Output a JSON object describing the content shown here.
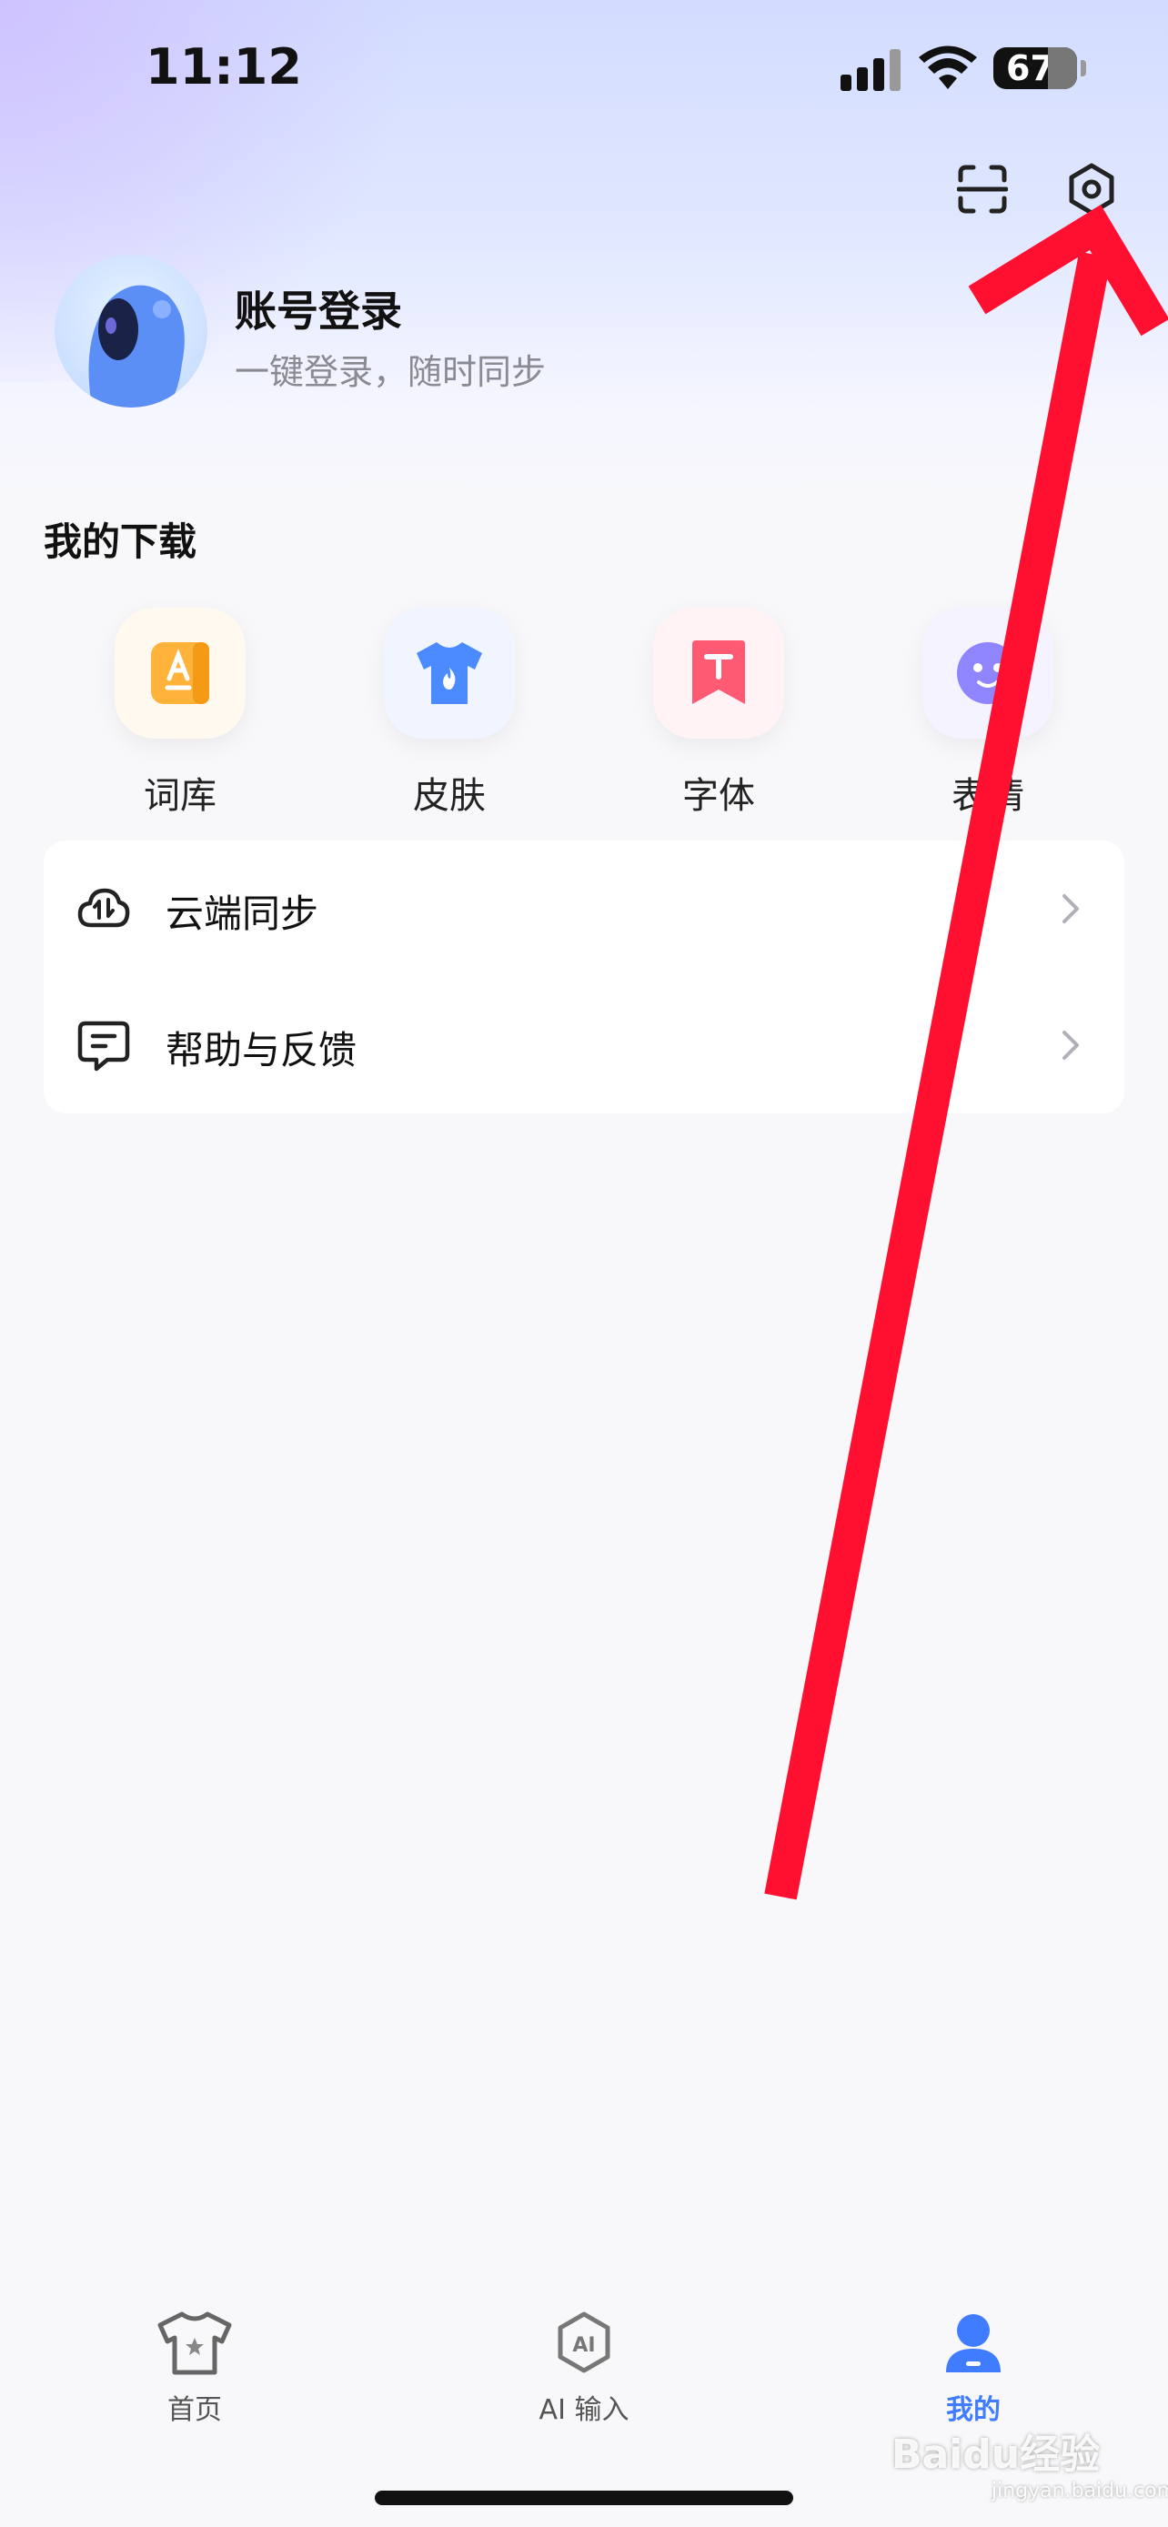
{
  "status_bar": {
    "time": "11:12",
    "battery": "67"
  },
  "account": {
    "title": "账号登录",
    "subtitle": "一键登录，随时同步"
  },
  "downloads": {
    "title": "我的下载",
    "items": [
      {
        "label": "词库",
        "icon": "dictionary-icon",
        "color": "#ffb33a"
      },
      {
        "label": "皮肤",
        "icon": "skin-tshirt-icon",
        "color": "#4b8bff"
      },
      {
        "label": "字体",
        "icon": "font-icon",
        "color": "#ff5a74"
      },
      {
        "label": "表情",
        "icon": "emoji-icon",
        "color": "#8f86ff"
      }
    ]
  },
  "menu": [
    {
      "label": "云端同步",
      "icon": "cloud-sync-icon"
    },
    {
      "label": "帮助与反馈",
      "icon": "feedback-icon"
    }
  ],
  "tabbar": {
    "tabs": [
      {
        "label": "首页",
        "icon": "home-tshirt-icon",
        "active": false
      },
      {
        "label": "AI 输入",
        "icon": "ai-input-icon",
        "active": false
      },
      {
        "label": "我的",
        "icon": "profile-icon",
        "active": true
      }
    ],
    "active_color": "#3f7cff"
  },
  "watermark": {
    "text": "Baidu经验",
    "sub": "jingyan.baidu.com"
  },
  "colors": {
    "annotation_arrow": "#ff1030"
  }
}
